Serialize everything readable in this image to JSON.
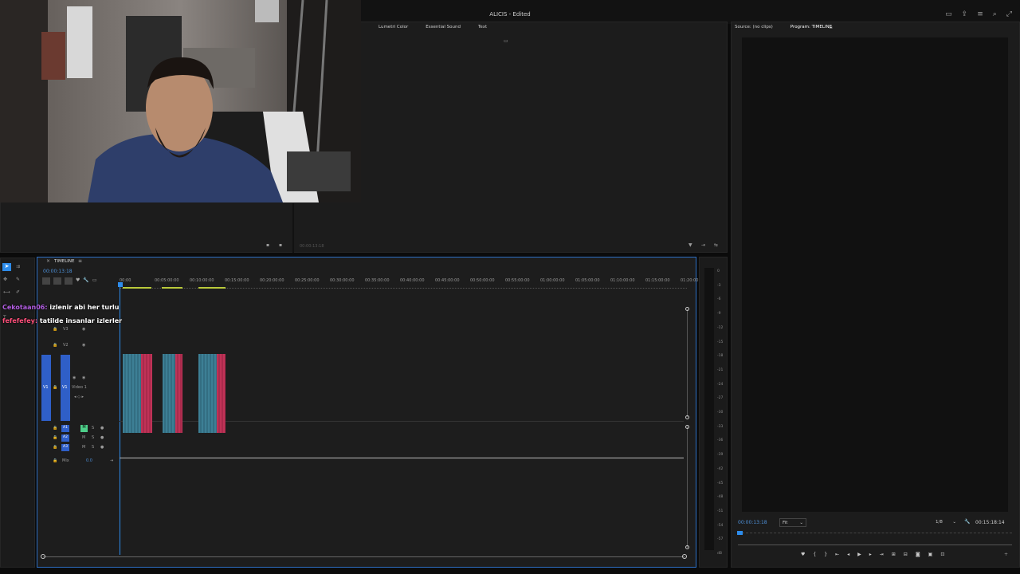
{
  "app": {
    "title": "ALICIS - Edited"
  },
  "effects_panel": {
    "tabs": [
      "Lumetri Color",
      "Essential Sound",
      "Text"
    ]
  },
  "source_panel": {
    "timecode": "00:00:13:18"
  },
  "program_monitor": {
    "tabs": [
      "Source: (no clips)",
      "Program: TIMELINE"
    ],
    "timecode": "00:00:13:18",
    "fit": "Fit",
    "resolution": "1/8",
    "duration": "00:15:18:14"
  },
  "timeline": {
    "title": "TIMELINE",
    "timecode": "00:00:13:18",
    "ruler": [
      "00:00",
      "00:05:00:00",
      "00:10:00:00",
      "00:15:00:00",
      "00:20:00:00",
      "00:25:00:00",
      "00:30:00:00",
      "00:35:00:00",
      "00:40:00:00",
      "00:45:00:00",
      "00:50:00:00",
      "00:55:00:00",
      "01:00:00:00",
      "01:05:00:00",
      "01:10:00:00",
      "01:15:00:00",
      "01:20:00:0"
    ],
    "tracks": {
      "v3": "V3",
      "v2": "V2",
      "v1": "V1",
      "v1_name": "Video 1",
      "a1": "A1",
      "a2": "A2",
      "a3": "A3",
      "mix_label": "Mix",
      "mix_value": "0.0"
    }
  },
  "meter": {
    "scale": [
      "0",
      "-3",
      "-6",
      "-9",
      "-12",
      "-15",
      "-18",
      "-21",
      "-24",
      "-27",
      "-30",
      "-33",
      "-36",
      "-39",
      "-42",
      "-45",
      "-48",
      "-51",
      "-54",
      "-57",
      "dB"
    ]
  },
  "chat": [
    {
      "user": "Cekotaan06:",
      "message": "izlenir abi her turlu",
      "user_color": "#b05ce0"
    },
    {
      "user": "fefefefey:",
      "message": "tatilde insanlar izlerler",
      "user_color": "#ff4f7a"
    }
  ],
  "colors": {
    "accent": "#2d8ceb",
    "clip_video": "#3d7f95",
    "clip_audio": "#c03257",
    "track_blue": "#2f5fc8"
  }
}
